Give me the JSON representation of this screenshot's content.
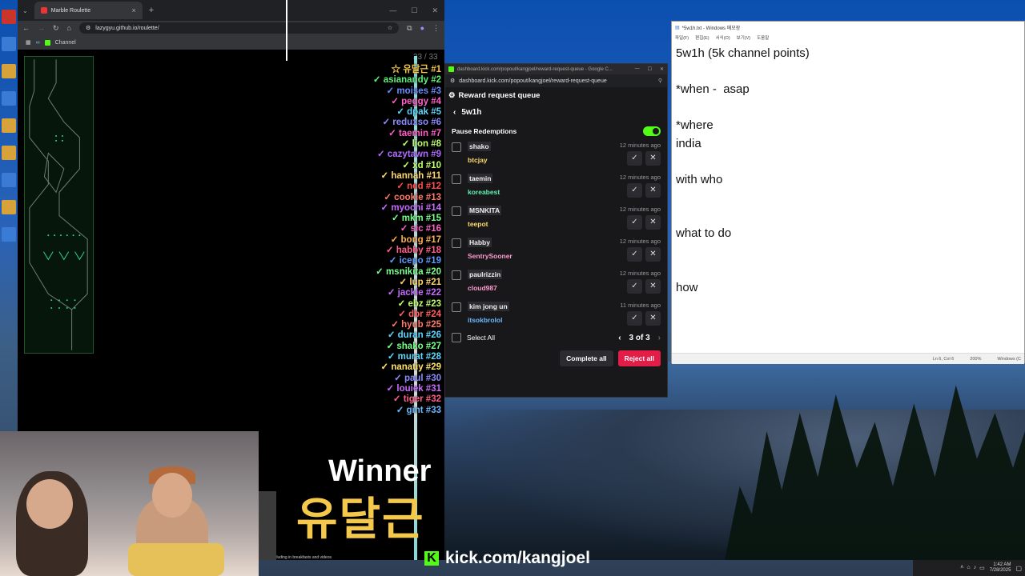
{
  "browser": {
    "tab_title": "Marble Roulette",
    "url": "lazygyu.github.io/roulette/",
    "bookmark": "Channel",
    "counter": "33 / 33",
    "ranking": [
      {
        "name": "☆ 유달근 #1",
        "color": "#f4c84a"
      },
      {
        "name": "✓ asianandy #2",
        "color": "#5cf27a"
      },
      {
        "name": "✓ moises #3",
        "color": "#6a8cff"
      },
      {
        "name": "✓ peggy #4",
        "color": "#ff5fc8"
      },
      {
        "name": "✓ dpak #5",
        "color": "#5ad8ff"
      },
      {
        "name": "✓ reduxso #6",
        "color": "#8c8cff"
      },
      {
        "name": "✓ taemin #7",
        "color": "#ff5fc8"
      },
      {
        "name": "✓ lion #8",
        "color": "#bfff6a"
      },
      {
        "name": "✓ cazytawn #9",
        "color": "#b06bff"
      },
      {
        "name": "✓ xd #10",
        "color": "#bfff6a"
      },
      {
        "name": "✓ hannah #11",
        "color": "#ffd86a"
      },
      {
        "name": "✓ ned #12",
        "color": "#ff4e4e"
      },
      {
        "name": "✓ cookie #13",
        "color": "#ff7a6a"
      },
      {
        "name": "✓ myochi #14",
        "color": "#c86bff"
      },
      {
        "name": "✓ mkm #15",
        "color": "#7aff8c"
      },
      {
        "name": "✓ sic #16",
        "color": "#ff5fc8"
      },
      {
        "name": "✓ bong #17",
        "color": "#ffae4e"
      },
      {
        "name": "✓ habby #18",
        "color": "#ff5f8c"
      },
      {
        "name": "✓ icepo #19",
        "color": "#5a9cff"
      },
      {
        "name": "✓ msnikita #20",
        "color": "#7aff8c"
      },
      {
        "name": "✓ lup #21",
        "color": "#ffd86a"
      },
      {
        "name": "✓ jackie #22",
        "color": "#c86bff"
      },
      {
        "name": "✓ ebz #23",
        "color": "#bfff6a"
      },
      {
        "name": "✓ dbr #24",
        "color": "#ff5f5f"
      },
      {
        "name": "✓ hyub #25",
        "color": "#ff7a6a"
      },
      {
        "name": "✓ duran #26",
        "color": "#5ad8ff"
      },
      {
        "name": "✓ shako #27",
        "color": "#7aff8c"
      },
      {
        "name": "✓ murat #28",
        "color": "#5ad8ff"
      },
      {
        "name": "✓ nanatiy #29",
        "color": "#ffe46a"
      },
      {
        "name": "✓ paul #30",
        "color": "#8c8cff"
      },
      {
        "name": "✓ louiek #31",
        "color": "#c86bff"
      },
      {
        "name": "✓ tiger #32",
        "color": "#ff5f8c"
      },
      {
        "name": "✓ gint #33",
        "color": "#6ab8ff"
      }
    ],
    "winner_label": "Winner",
    "winner_name": "유달근",
    "caption": "shows, including in breakfasts and videos"
  },
  "stream": {
    "kick_url": "kick.com/kangjoel"
  },
  "reward": {
    "window_title": "dashboard.kick.com/popout/kangjoel/reward-request-queue - Google C...",
    "url": "dashboard.kick.com/popout/kangjoel/reward-request-queue",
    "header": "Reward request queue",
    "reward_name": "5w1h",
    "pause_label": "Pause Redemptions",
    "items": [
      {
        "user": "shako",
        "time": "12 minutes ago",
        "buyer": "btcjay",
        "color": "#ffd86a"
      },
      {
        "user": "taemin",
        "time": "12 minutes ago",
        "buyer": "koreabest",
        "color": "#5cf2b0"
      },
      {
        "user": "MSNKITA",
        "time": "12 minutes ago",
        "buyer": "teepot",
        "color": "#ffd86a"
      },
      {
        "user": "Habby",
        "time": "12 minutes ago",
        "buyer": "SentrySooner",
        "color": "#ff9ad0"
      },
      {
        "user": "paulrizzin",
        "time": "12 minutes ago",
        "buyer": "cloud987",
        "color": "#ff9ad0"
      },
      {
        "user": "kim jong un",
        "time": "11 minutes ago",
        "buyer": "itsokbrolol",
        "color": "#6ab8ff"
      }
    ],
    "select_all": "Select All",
    "page": "3 of 3",
    "complete_all": "Complete all",
    "reject_all": "Reject all"
  },
  "notepad": {
    "title": "*5w1h.txt - Windows 메모장",
    "menu": [
      "파일(F)",
      "편집(E)",
      "서식(O)",
      "보기(V)",
      "도움말"
    ],
    "content": "5w1h (5k channel points)\n\n*when -  asap\n\n*where\nindia\n\nwith who\n\n\nwhat to do\n\n\nhow",
    "status_pos": "Ln 6, Col 6",
    "status_zoom": "200%",
    "status_eol": "Windows (C"
  },
  "taskbar": {
    "time": "1:42 AM",
    "date": "7/28/2025"
  }
}
